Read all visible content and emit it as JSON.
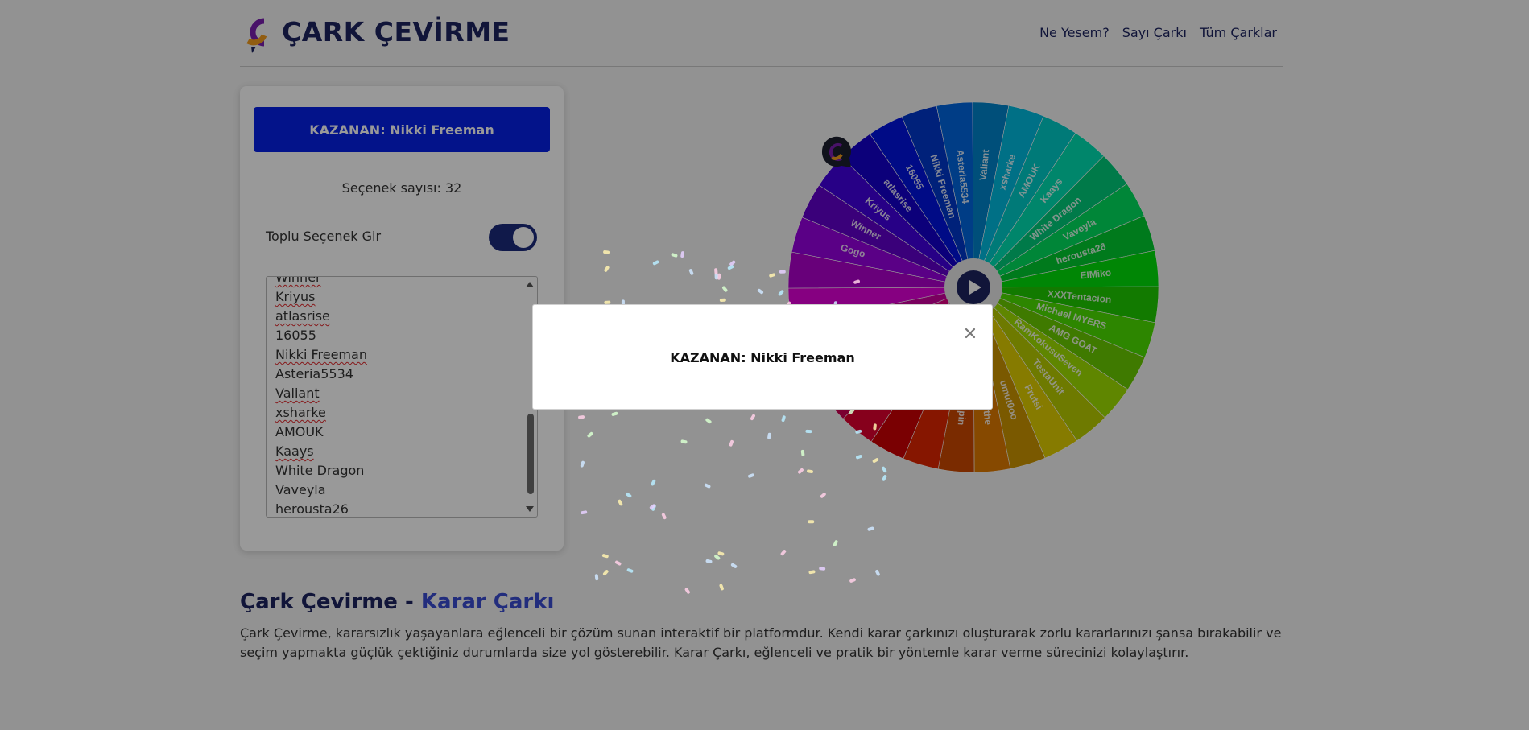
{
  "header": {
    "logo_text": "ÇARK ÇEVİRME",
    "nav": [
      "Ne Yesem?",
      "Sayı Çarkı",
      "Tüm Çarklar"
    ]
  },
  "panel": {
    "winner_button": "KAZANAN: Nikki Freeman",
    "option_count": "Seçenek sayısı: 32",
    "bulk_toggle_label": "Toplu Seçenek Gir",
    "bulk_toggle_on": true,
    "options_visible": [
      "Winner",
      "Kriyus",
      "atlasrise",
      "16055",
      "Nikki Freeman",
      "Asteria5534",
      "Valiant",
      "xsharke",
      "AMOUK",
      "Kaays",
      "White Dragon",
      "Vaveyla",
      "herousta26"
    ]
  },
  "wheel": {
    "segment_count": 32,
    "labels": [
      "Gogo",
      "Winner",
      "Kriyus",
      "atlasrise",
      "16055",
      "Nikki Freeman",
      "Asteria5534",
      "Valiant",
      "xsharke",
      "AMOUK",
      "Kaays",
      "White Dragon",
      "Vaveyla",
      "herousta26",
      "EIMiko",
      "XXXTentacion",
      "Michael MYERS",
      "AMG GOAT",
      "RamKokusuSeven",
      "TestaUnit",
      "Frutsi",
      "umut0oo",
      "Kirothe",
      "Lupin",
      "",
      "",
      "",
      "",
      "",
      "",
      "",
      ""
    ],
    "play_icon": "play-icon"
  },
  "article": {
    "title_main": "Çark Çevirme - ",
    "title_accent": "Karar Çarkı",
    "body": "Çark Çevirme, kararsızlık yaşayanlara eğlenceli bir çözüm sunan interaktif bir platformdur. Kendi karar çarkınızı oluşturarak zorlu kararlarınızı şansa bırakabilir ve seçim yapmakta güçlük çektiğiniz durumlarda size yol gösterebilir. Karar Çarkı, eğlenceli ve pratik bir yöntemle karar verme sürecinizi kolaylaştırır."
  },
  "modal": {
    "title": "KAZANAN: Nikki Freeman",
    "close_icon": "close-icon"
  },
  "colors": {
    "accent": "#0520e6",
    "brand": "#1d2460"
  }
}
